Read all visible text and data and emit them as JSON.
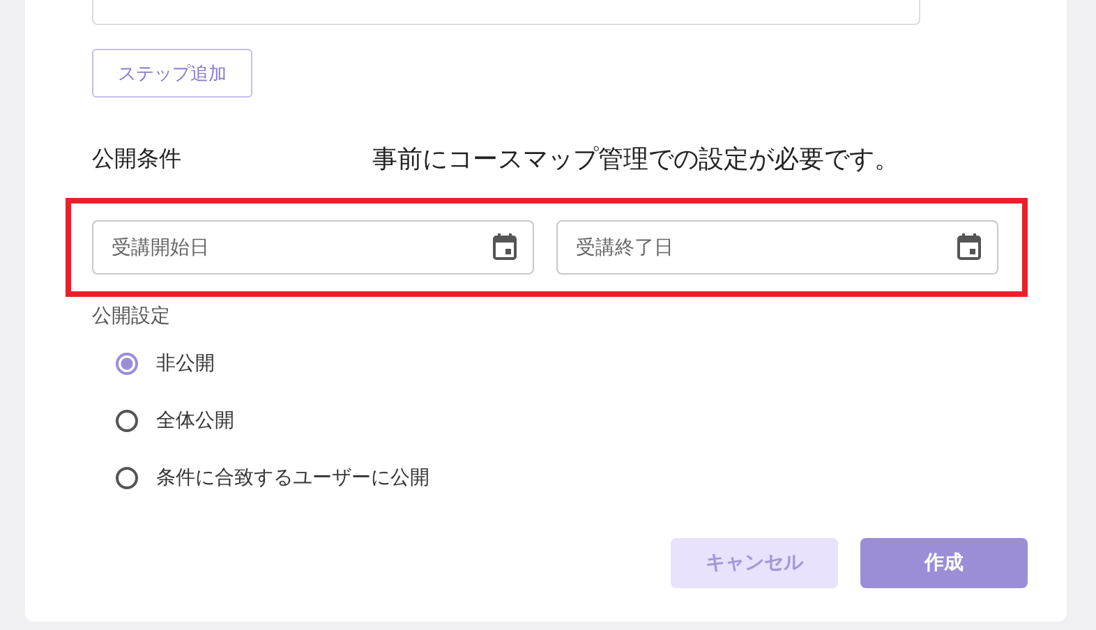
{
  "add_step_button": "ステップ追加",
  "publish_conditions": {
    "label": "公開条件",
    "note": "事前にコースマップ管理での設定が必要です。",
    "date_fields": [
      {
        "placeholder": "受講開始日"
      },
      {
        "placeholder": "受講終了日"
      }
    ]
  },
  "publish_settings": {
    "label": "公開設定",
    "options": [
      {
        "label": "非公開",
        "selected": true
      },
      {
        "label": "全体公開",
        "selected": false
      },
      {
        "label": "条件に合致するユーザーに公開",
        "selected": false
      }
    ]
  },
  "buttons": [
    {
      "label": "キャンセル",
      "kind": "secondary"
    },
    {
      "label": "作成",
      "kind": "primary"
    }
  ]
}
